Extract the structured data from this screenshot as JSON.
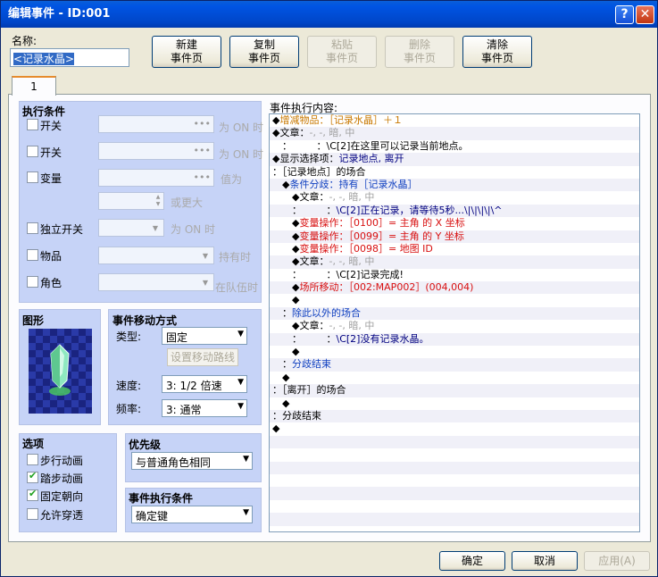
{
  "window": {
    "title": "编辑事件 - ID:001",
    "help": "?",
    "close": "✕"
  },
  "name": {
    "label": "名称:",
    "value": "<记录水晶>"
  },
  "toolbar": {
    "new_page": [
      "新建",
      "事件页"
    ],
    "copy_page": [
      "复制",
      "事件页"
    ],
    "paste_page": [
      "粘贴",
      "事件页"
    ],
    "delete_page": [
      "删除",
      "事件页"
    ],
    "clear_page": [
      "清除",
      "事件页"
    ]
  },
  "tabs": [
    "1"
  ],
  "conditions": {
    "title": "执行条件",
    "switch1": {
      "label": "开关",
      "suffix": "为 ON 时"
    },
    "switch2": {
      "label": "开关",
      "suffix": "为 ON 时"
    },
    "variable": {
      "label": "变量",
      "suffix": "值为",
      "more": "或更大"
    },
    "self_switch": {
      "label": "独立开关",
      "suffix": "为 ON 时"
    },
    "item": {
      "label": "物品",
      "suffix": "持有时"
    },
    "actor": {
      "label": "角色",
      "suffix": "在队伍时"
    }
  },
  "graphic": {
    "title": "图形"
  },
  "movement": {
    "title": "事件移动方式",
    "type_label": "类型:",
    "type_value": "固定",
    "route_button": "设置移动路线",
    "speed_label": "速度:",
    "speed_value": "3: 1/2 倍速",
    "freq_label": "频率:",
    "freq_value": "3: 通常"
  },
  "options": {
    "title": "选项",
    "walk_anim": {
      "label": "步行动画",
      "checked": false
    },
    "step_anim": {
      "label": "踏步动画",
      "checked": true
    },
    "dir_fix": {
      "label": "固定朝向",
      "checked": true
    },
    "through": {
      "label": "允许穿透",
      "checked": false
    }
  },
  "priority": {
    "title": "优先级",
    "value": "与普通角色相同"
  },
  "trigger": {
    "title": "事件执行条件",
    "value": "确定键"
  },
  "contents": {
    "title": "事件执行内容:",
    "lines": [
      [
        [
          "◆",
          ""
        ],
        [
          "增减物品：［记录水晶］＋１",
          "c-orange"
        ]
      ],
      [
        [
          "◆",
          ""
        ],
        [
          "文章：",
          ""
        ],
        [
          "-, -, 暗, 中",
          "c-gray"
        ]
      ],
      [
        [
          "　：　　　：",
          ""
        ],
        [
          "\\C[2]在这里可以记录当前地点。",
          ""
        ]
      ],
      [
        [
          "◆",
          ""
        ],
        [
          "显示选择项：",
          ""
        ],
        [
          "记录地点, 离开",
          "c-dblue"
        ]
      ],
      [
        [
          "：［记录地点］的场合",
          ""
        ]
      ],
      [
        [
          "　",
          ""
        ],
        [
          "◆",
          ""
        ],
        [
          "条件分歧：持有［记录水晶］",
          "c-blue"
        ]
      ],
      [
        [
          "　　",
          ""
        ],
        [
          "◆",
          ""
        ],
        [
          "文章：",
          ""
        ],
        [
          "-, -, 暗, 中",
          "c-gray"
        ]
      ],
      [
        [
          "　　：　　　：",
          ""
        ],
        [
          "\\C[2]正在记录，请等待5秒...\\|\\|\\|\\|\\^",
          "c-dblue"
        ]
      ],
      [
        [
          "　　",
          ""
        ],
        [
          "◆",
          ""
        ],
        [
          "变量操作：［0100］= 主角 的 X 坐标",
          "c-red"
        ]
      ],
      [
        [
          "　　",
          ""
        ],
        [
          "◆",
          ""
        ],
        [
          "变量操作：［0099］= 主角 的 Y 坐标",
          "c-red"
        ]
      ],
      [
        [
          "　　",
          ""
        ],
        [
          "◆",
          ""
        ],
        [
          "变量操作：［0098］= 地图 ID",
          "c-red"
        ]
      ],
      [
        [
          "　　",
          ""
        ],
        [
          "◆",
          ""
        ],
        [
          "文章：",
          ""
        ],
        [
          "-, -, 暗, 中",
          "c-gray"
        ]
      ],
      [
        [
          "　　：　　　：",
          ""
        ],
        [
          "\\C[2]记录完成!",
          ""
        ]
      ],
      [
        [
          "　　",
          ""
        ],
        [
          "◆",
          ""
        ],
        [
          "场所移动：［002:MAP002］(004,004)",
          "c-red"
        ]
      ],
      [
        [
          "　　",
          ""
        ],
        [
          "◆",
          ""
        ]
      ],
      [
        [
          "　：",
          ""
        ],
        [
          "除此以外的场合",
          "c-blue"
        ]
      ],
      [
        [
          "　　",
          ""
        ],
        [
          "◆",
          ""
        ],
        [
          "文章：",
          ""
        ],
        [
          "-, -, 暗, 中",
          "c-gray"
        ]
      ],
      [
        [
          "　　：　　　：",
          ""
        ],
        [
          "\\C[2]没有记录水晶。",
          "c-dblue"
        ]
      ],
      [
        [
          "　　",
          ""
        ],
        [
          "◆",
          ""
        ]
      ],
      [
        [
          "　：",
          ""
        ],
        [
          "分歧结束",
          "c-blue"
        ]
      ],
      [
        [
          "　",
          ""
        ],
        [
          "◆",
          ""
        ]
      ],
      [
        [
          "：［离开］的场合",
          ""
        ]
      ],
      [
        [
          "　",
          ""
        ],
        [
          "◆",
          ""
        ]
      ],
      [
        [
          "：分歧结束",
          ""
        ]
      ],
      [
        [
          "◆",
          ""
        ]
      ]
    ]
  },
  "footer": {
    "ok": "确定",
    "cancel": "取消",
    "apply": "应用(A)"
  }
}
